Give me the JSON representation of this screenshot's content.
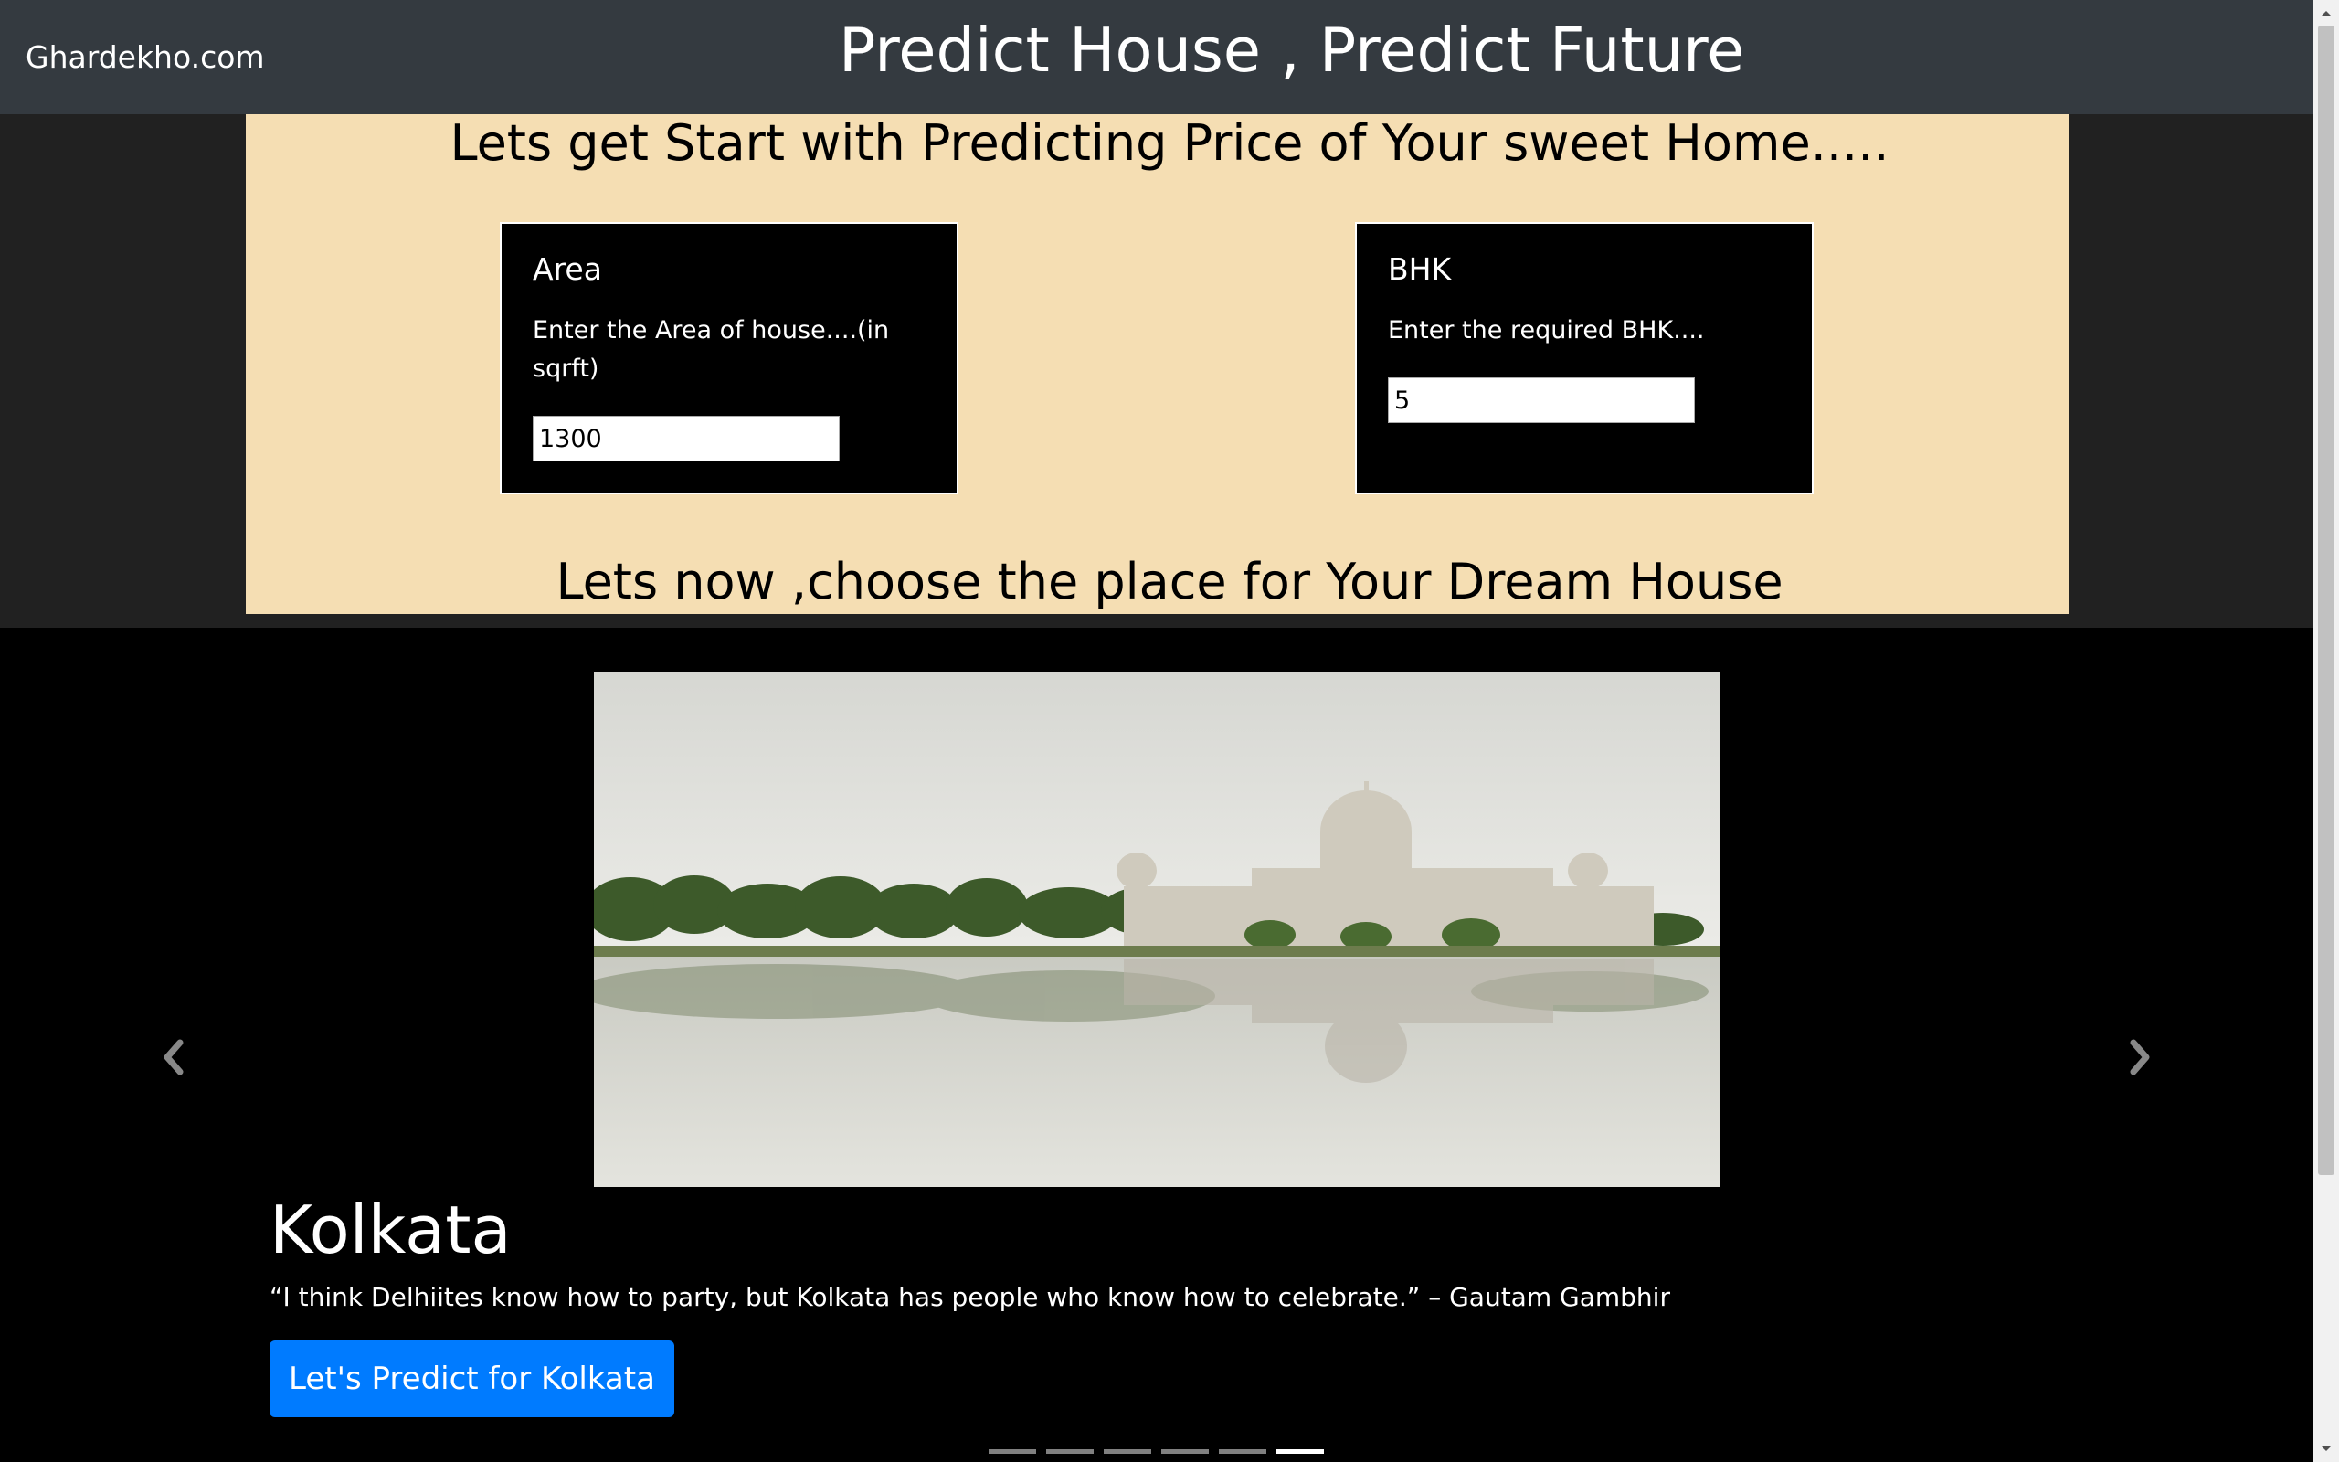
{
  "navbar": {
    "brand": "Ghardekho.com",
    "title": "Predict House , Predict Future"
  },
  "intro": {
    "heading": "Lets get Start with Predicting Price of Your sweet Home....."
  },
  "area_card": {
    "title": "Area",
    "text": "Enter the Area of house....(in sqrft)",
    "value": "1300"
  },
  "bhk_card": {
    "title": "BHK",
    "text": "Enter the required BHK....",
    "value": "5"
  },
  "place": {
    "heading": "Lets now ,choose the place for Your Dream House"
  },
  "carousel": {
    "slide_title": "Kolkata",
    "slide_quote": "“I think Delhiites know how to party, but Kolkata has people who know how to celebrate.” – Gautam Gambhir",
    "button_label": "Let's Predict for Kolkata",
    "indicator_count": 6,
    "active_index": 5,
    "prev_icon": "chevron-left-icon",
    "next_icon": "chevron-right-icon"
  },
  "colors": {
    "navbar_bg": "#343a40",
    "panel_bg": "#f5deb3",
    "band_bg": "#212121",
    "button_bg": "#007bff"
  }
}
